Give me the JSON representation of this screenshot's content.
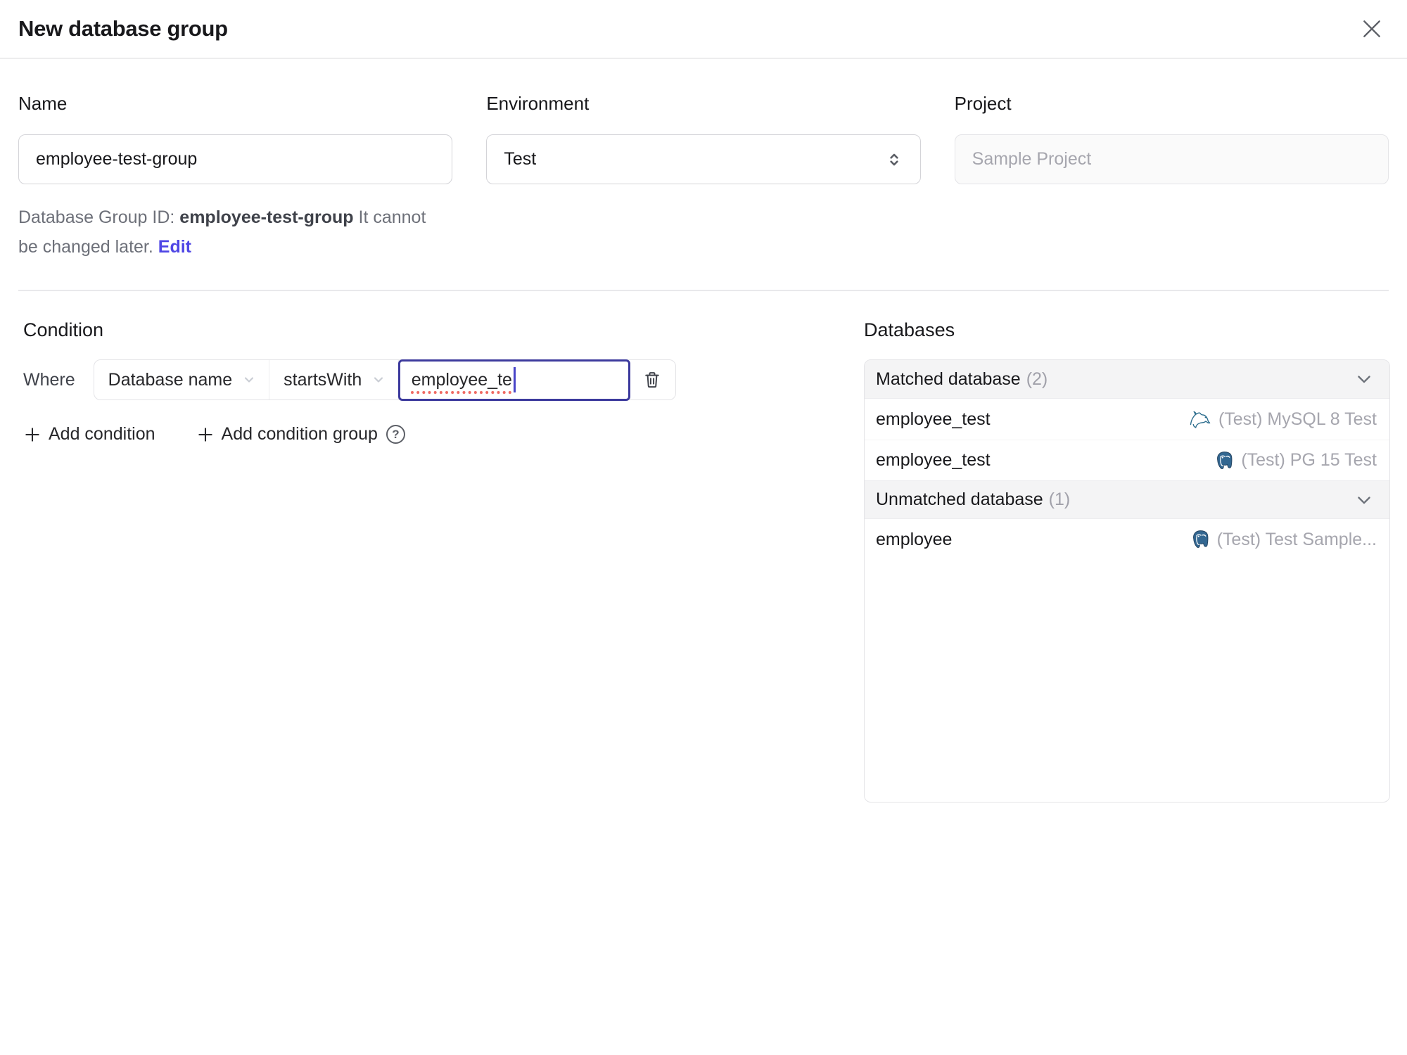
{
  "dialog": {
    "title": "New database group"
  },
  "form": {
    "name": {
      "label": "Name",
      "value": "employee-test-group"
    },
    "environment": {
      "label": "Environment",
      "value": "Test"
    },
    "project": {
      "label": "Project",
      "value": "Sample Project"
    },
    "id_note": {
      "prefix": "Database Group ID: ",
      "id": "employee-test-group",
      "suffix": " It cannot be changed later. ",
      "edit_link": "Edit"
    }
  },
  "condition": {
    "heading": "Condition",
    "where_label": "Where",
    "field": "Database name",
    "operator": "startsWith",
    "value": "employee_te",
    "add_condition": "Add condition",
    "add_condition_group": "Add condition group",
    "help_glyph": "?"
  },
  "databases": {
    "heading": "Databases",
    "groups": [
      {
        "title": "Matched database",
        "count": "(2)",
        "rows": [
          {
            "name": "employee_test",
            "engine": "mysql",
            "instance": "(Test) MySQL 8 Test"
          },
          {
            "name": "employee_test",
            "engine": "postgres",
            "instance": "(Test) PG 15 Test"
          }
        ]
      },
      {
        "title": "Unmatched database",
        "count": "(1)",
        "rows": [
          {
            "name": "employee",
            "engine": "postgres",
            "instance": "(Test) Test Sample..."
          }
        ]
      }
    ]
  },
  "colors": {
    "accent_indigo": "#4f46e5",
    "focus_border": "#3c3a9d",
    "spellcheck_red": "#ef6a63",
    "header_bg": "#f4f4f5",
    "border": "#e4e4e7",
    "muted_text": "#a6a6ae",
    "mysql_teal": "#2f6f8f",
    "postgres_blue": "#336791"
  }
}
